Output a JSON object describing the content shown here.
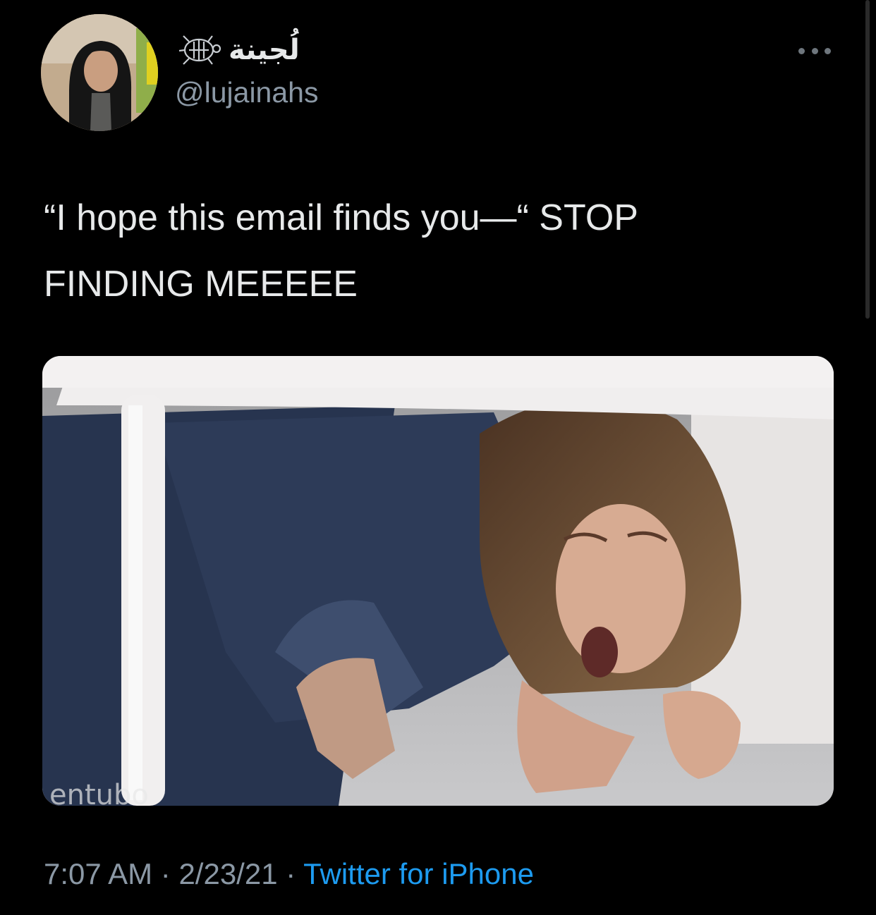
{
  "tweet": {
    "author": {
      "display_name": "لُجينة",
      "handle": "@lujainahs",
      "badge_icon": "turtle-icon",
      "avatar_icon": "avatar-photo"
    },
    "more_icon": "more-options-icon",
    "text": "“I hope this email finds you—“ STOP\nFINDING MEEEEE",
    "media": {
      "icon": "attached-photo",
      "watermark": "entubo"
    },
    "meta": {
      "time": "7:07 AM",
      "separator": " · ",
      "date": "2/23/21",
      "source": "Twitter for iPhone"
    }
  },
  "colors": {
    "background": "#000000",
    "text": "#e7e9ea",
    "secondary_text": "#8b98a5",
    "link": "#1d9bf0"
  }
}
